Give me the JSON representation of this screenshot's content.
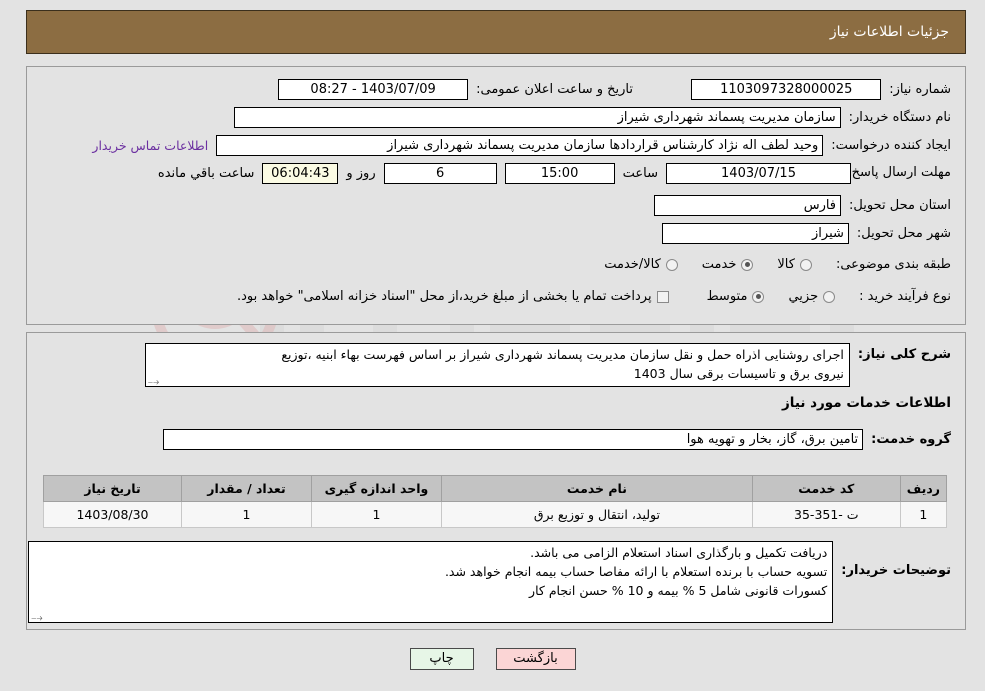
{
  "header": {
    "title": "جزئیات اطلاعات نیاز"
  },
  "form": {
    "need_number_label": "شماره نیاز:",
    "need_number_value": "1103097328000025",
    "announce_label": "تاریخ و ساعت اعلان عمومی:",
    "announce_value": "1403/07/09 - 08:27",
    "buyer_org_label": "نام دستگاه خریدار:",
    "buyer_org_value": "سازمان مدیریت پسماند شهرداری شیراز",
    "creator_label": "ایجاد کننده درخواست:",
    "creator_value": "وحید لطف اله نژاد کارشناس قراردادها سازمان مدیریت پسماند شهرداری شیراز",
    "contact_link": "اطلاعات تماس خریدار",
    "deadline_label": "مهلت ارسال پاسخ: تا تاریخ:",
    "deadline_date": "1403/07/15",
    "hour_label": "ساعت",
    "hour_value": "15:00",
    "days_value": "6",
    "days_label": "روز و",
    "countdown_value": "06:04:43",
    "countdown_label": "ساعت باقي مانده",
    "province_label": "استان محل تحویل:",
    "province_value": "فارس",
    "city_label": "شهر محل تحویل:",
    "city_value": "شیراز",
    "category_label": "طبقه بندی موضوعی:",
    "category_options": [
      "کالا",
      "خدمت",
      "کالا/خدمت"
    ],
    "category_selected": "خدمت",
    "process_label": "نوع فرآیند خرید :",
    "process_options": [
      "جزیي",
      "متوسط"
    ],
    "process_selected": "متوسط",
    "treasury_checkbox_label": "پرداخت تمام یا بخشی از مبلغ خرید،از محل \"اسناد خزانه اسلامی\" خواهد بود.",
    "treasury_checked": false
  },
  "description": {
    "label": "شرح کلی نیاز:",
    "lines": [
      "اجرای روشنایی اذراه حمل و نقل سازمان مدیریت پسماند شهرداری شیراز بر اساس فهرست بهاء ابنیه ،توزیع",
      "نیروی برق و تاسیسات برقی سال 1403"
    ]
  },
  "services": {
    "section_title": "اطلاعات خدمات مورد نیاز",
    "group_label": "گروه خدمت:",
    "group_value": "تامین برق، گاز، بخار و تهویه هوا",
    "table": {
      "headers": [
        "ردیف",
        "کد خدمت",
        "نام خدمت",
        "واحد اندازه گیری",
        "تعداد / مقدار",
        "تاریخ نیاز"
      ],
      "rows": [
        [
          "1",
          "ت -351-35",
          "تولید، انتقال و توزیع برق",
          "1",
          "1",
          "1403/08/30"
        ]
      ]
    }
  },
  "buyer_notes": {
    "label": "توضیحات خریدار:",
    "lines": [
      "دریافت تکمیل و بارگذاری اسناد استعلام الزامی می باشد.",
      "تسویه حساب با برنده استعلام با ارائه مفاصا حساب بیمه انجام خواهد شد.",
      "کسورات قانونی شامل 5 % بیمه و 10 % حسن انجام کار"
    ]
  },
  "footer": {
    "print_label": "چاپ",
    "back_label": "بازگشت"
  },
  "colors": {
    "header_brown": "#8c6d42",
    "page_bg": "#e3e3e3",
    "link_purple": "#6b2fa0",
    "table_header": "#c3c3c3",
    "print_btn": "#e7f6e7",
    "back_btn": "#fbd5d5"
  }
}
